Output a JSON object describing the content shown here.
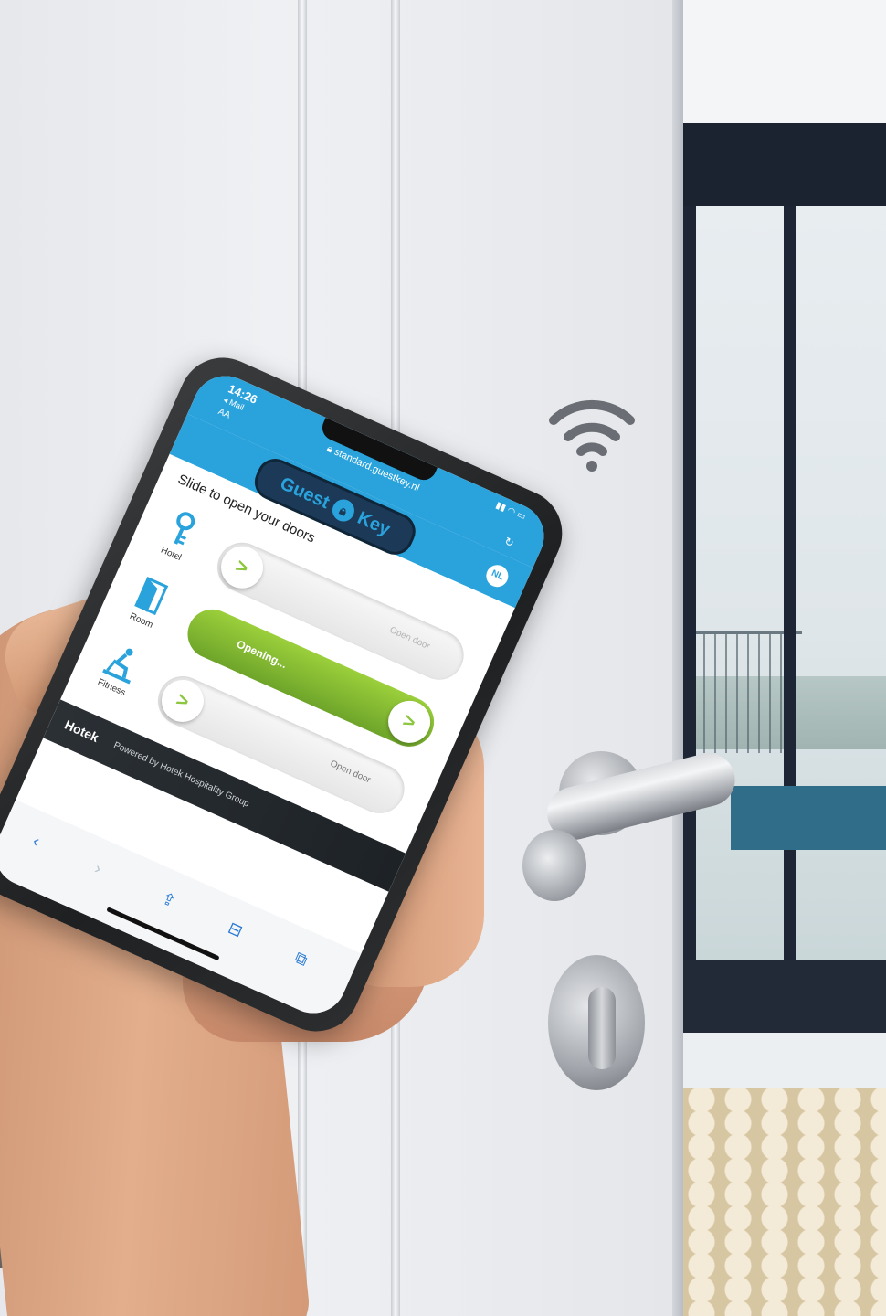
{
  "phone": {
    "status_time": "14:26",
    "status_back": "◂ Mail",
    "status_aa": "AA",
    "url": "standard.guestkey.nl",
    "brand_left": "Guest",
    "brand_right": "Key",
    "language": "NL",
    "headline": "Slide to open your doors",
    "doors": [
      {
        "label": "Hotel",
        "slider_text": "Open door",
        "state": "idle"
      },
      {
        "label": "Room",
        "slider_text": "Opening...",
        "state": "opening"
      },
      {
        "label": "Fitness",
        "slider_text": "Open door",
        "state": "idle"
      }
    ],
    "footer_brand": "Hotek",
    "footer_powered": "Powered by Hotek Hospitality Group"
  },
  "colors": {
    "accent_blue": "#2aa3dd",
    "opening_green": "#8dc63f",
    "navy": "#1c3a58"
  },
  "icons": {
    "door_signal": "wifi-icon",
    "hotel": "key-icon",
    "room": "door-icon",
    "fitness": "exercise-bike-icon"
  }
}
